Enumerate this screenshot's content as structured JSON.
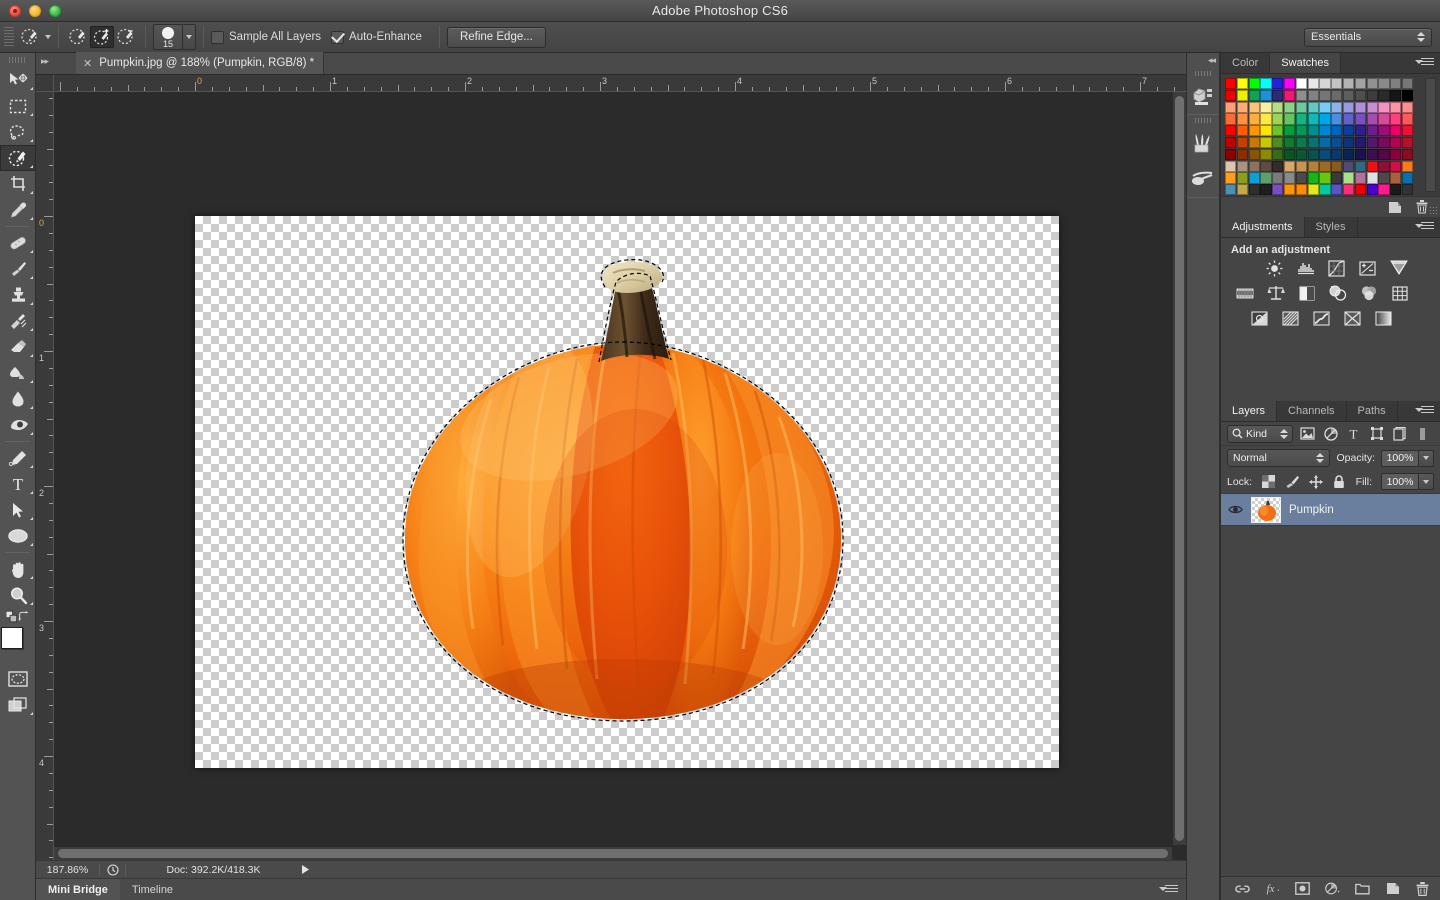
{
  "window": {
    "title": "Adobe Photoshop CS6",
    "traffic_lights": [
      "close",
      "minimize",
      "zoom"
    ]
  },
  "options_bar": {
    "tool_preset_label": "quick-selection-tool-preset",
    "mode_buttons": [
      "new-selection",
      "add-to-selection",
      "subtract-from-selection"
    ],
    "active_mode_index": 1,
    "brush_size": "15",
    "sample_all_layers": {
      "label": "Sample All Layers",
      "checked": false
    },
    "auto_enhance": {
      "label": "Auto-Enhance",
      "checked": true
    },
    "refine_edge": "Refine Edge...",
    "workspace": "Essentials"
  },
  "toolbox": {
    "tools": [
      {
        "name": "move-tool",
        "active": false
      },
      {
        "name": "rectangular-marquee-tool",
        "active": false
      },
      {
        "name": "lasso-tool",
        "active": false
      },
      {
        "name": "quick-selection-tool",
        "active": true
      },
      {
        "name": "crop-tool",
        "active": false
      },
      {
        "name": "eyedropper-tool",
        "active": false
      },
      {
        "name": "spot-healing-brush-tool",
        "active": false
      },
      {
        "name": "brush-tool",
        "active": false
      },
      {
        "name": "clone-stamp-tool",
        "active": false
      },
      {
        "name": "history-brush-tool",
        "active": false
      },
      {
        "name": "eraser-tool",
        "active": false
      },
      {
        "name": "gradient-tool",
        "active": false
      },
      {
        "name": "blur-tool",
        "active": false
      },
      {
        "name": "dodge-tool",
        "active": false
      },
      {
        "name": "pen-tool",
        "active": false
      },
      {
        "name": "horizontal-type-tool",
        "active": false
      },
      {
        "name": "path-selection-tool",
        "active": false
      },
      {
        "name": "ellipse-tool",
        "active": false
      },
      {
        "name": "hand-tool",
        "active": false
      },
      {
        "name": "zoom-tool",
        "active": false
      }
    ],
    "foreground_color": "#ffffff",
    "background_color": "#ffffff",
    "quick_mask": "edit-in-quick-mask-mode",
    "screen_mode": "change-screen-mode"
  },
  "document": {
    "tab_title": "Pumpkin.jpg @ 188% (Pumpkin, RGB/8) *",
    "ruler_h_labels": [
      "0",
      "1",
      "2",
      "3",
      "4",
      "5",
      "6",
      "7"
    ],
    "ruler_v_labels": [
      "0",
      "1",
      "2",
      "3",
      "4"
    ],
    "canvas_alt": "pumpkin-on-transparent-background"
  },
  "status_bar": {
    "zoom": "187.86%",
    "doc_info": "Doc: 392.2K/418.3K"
  },
  "bottom_tabs": [
    {
      "label": "Mini Bridge",
      "active": true
    },
    {
      "label": "Timeline",
      "active": false
    }
  ],
  "mini_dock": {
    "items": [
      "history-panel-icon",
      "brush-panel-icon",
      "tool-presets-icon"
    ]
  },
  "panels": {
    "color_swatches": {
      "tabs": [
        {
          "label": "Color",
          "active": false
        },
        {
          "label": "Swatches",
          "active": true
        }
      ],
      "swatch_rows": [
        [
          "#ff0000",
          "#ffff00",
          "#00ff00",
          "#00ffff",
          "#2222dd",
          "#ff00ff",
          "#ffffff",
          "#e8e8e8",
          "#d6d6d6",
          "#c4c4c4",
          "#b3b3b3",
          "#a2a2a2",
          "#919191",
          "#8a8a8a",
          "#808080",
          "#777777"
        ],
        [
          "#ee0000",
          "#eeee00",
          "#12a05a",
          "#1f8fd8",
          "#2b2b7a",
          "#f01a72",
          "#8e8e8e",
          "#828282",
          "#767676",
          "#6a6a6a",
          "#5e5e5e",
          "#4f4f4f",
          "#3c3c3c",
          "#2b2b2b",
          "#161616",
          "#000000"
        ],
        [
          "#ff9e72",
          "#ffab73",
          "#ffc27a",
          "#fcf0a0",
          "#b6dd87",
          "#8fd18a",
          "#6fc9a0",
          "#63c9c4",
          "#77cdf5",
          "#8fb2e8",
          "#9a9ade",
          "#b08fd8",
          "#c78ed0",
          "#f291c3",
          "#ff94a8",
          "#ff8f8f"
        ],
        [
          "#ff6a33",
          "#ff9240",
          "#ffae3e",
          "#ffe84a",
          "#9ed35a",
          "#67c261",
          "#13b47d",
          "#12b9b9",
          "#00a7e8",
          "#4e8ede",
          "#5d63c8",
          "#7a4fc0",
          "#a64bb0",
          "#d84a9a",
          "#ff3f7e",
          "#ff5a5a"
        ],
        [
          "#ff0000",
          "#ff5e00",
          "#ff9500",
          "#ffe500",
          "#6cc424",
          "#00a13c",
          "#009a55",
          "#008f8f",
          "#0086d6",
          "#0065c0",
          "#0b3f9e",
          "#2d1f8c",
          "#6b1e8c",
          "#9c0d7a",
          "#ee0066",
          "#ee1133"
        ],
        [
          "#c40000",
          "#c44000",
          "#c87a00",
          "#c8c800",
          "#4f8c1e",
          "#0e7a30",
          "#0c7a4a",
          "#0b7272",
          "#0a6aa8",
          "#0a4f96",
          "#0b3578",
          "#241a6e",
          "#55176e",
          "#7a0a60",
          "#b80052",
          "#b81029"
        ],
        [
          "#8b0000",
          "#8b2f00",
          "#8b5500",
          "#8b8b00",
          "#376b17",
          "#0a5622",
          "#0a5636",
          "#0a5252",
          "#084d78",
          "#083a6b",
          "#082556",
          "#1a124f",
          "#3c0f4f",
          "#560745",
          "#8c003c",
          "#8c0c1f"
        ],
        [
          "#dcc6ad",
          "#a99184",
          "#8c7061",
          "#5d4c42",
          "#332c29",
          "#d8a86a",
          "#c89456",
          "#b57f3c",
          "#9e6a2a",
          "#8a5a1f",
          "#4c4c76",
          "#2e6b80",
          "#ee1111",
          "#8c1035",
          "#d01046",
          "#ff7a1a"
        ],
        [
          "#ff9d1c",
          "#8b9e1c",
          "#0e9fd8",
          "#5da16a",
          "#7a7a7a",
          "#8a8a8a",
          "#4a4a4a",
          "#17b51a",
          "#6ac412",
          "#3a3a3a",
          "#a9e08a",
          "#b3709a",
          "#e0e0e0",
          "#4a4a4a",
          "#a8613a",
          "#0d6fa8"
        ],
        [
          "#4b8fb2",
          "#c3a84e",
          "#2e2e2e",
          "#1f1f1f",
          "#7a4fc0",
          "#ff9500",
          "#ff8c00",
          "#e3e81a",
          "#00c9a0",
          "#5b52c8",
          "#ff2d78",
          "#ee0000",
          "#4b00d0",
          "#ff1a8c",
          "#1a1a1a",
          "#333333"
        ]
      ],
      "footer_buttons": [
        "new-swatch-icon",
        "delete-swatch-icon"
      ]
    },
    "adjustments": {
      "tabs": [
        {
          "label": "Adjustments",
          "active": true
        },
        {
          "label": "Styles",
          "active": false
        }
      ],
      "heading": "Add an adjustment",
      "rows": [
        [
          "brightness-contrast-icon",
          "levels-icon",
          "curves-icon",
          "exposure-icon",
          "vibrance-icon"
        ],
        [
          "hue-saturation-icon",
          "color-balance-icon",
          "black-white-icon",
          "photo-filter-icon",
          "channel-mixer-icon",
          "color-lookup-icon"
        ],
        [
          "invert-icon",
          "posterize-icon",
          "threshold-icon",
          "selective-color-icon",
          "gradient-map-icon"
        ]
      ]
    },
    "layers": {
      "tabs": [
        {
          "label": "Layers",
          "active": true
        },
        {
          "label": "Channels",
          "active": false
        },
        {
          "label": "Paths",
          "active": false
        }
      ],
      "filter_label": "Kind",
      "filter_icons": [
        "pixel-filter-icon",
        "adjustment-filter-icon",
        "type-filter-icon",
        "shape-filter-icon",
        "smart-object-filter-icon",
        "filter-toggle-icon"
      ],
      "blend_mode": "Normal",
      "opacity_label": "Opacity:",
      "opacity_value": "100%",
      "lock_label": "Lock:",
      "lock_icons": [
        "lock-transparent-pixels-icon",
        "lock-image-pixels-icon",
        "lock-position-icon",
        "lock-all-icon"
      ],
      "fill_label": "Fill:",
      "fill_value": "100%",
      "items": [
        {
          "name": "Pumpkin",
          "visible": true,
          "selected": true
        }
      ],
      "footer_buttons": [
        "link-layers-icon",
        "layer-style-icon",
        "layer-mask-icon",
        "new-adjustment-layer-icon",
        "new-group-icon",
        "new-layer-icon",
        "delete-layer-icon"
      ]
    }
  },
  "colors": {
    "accent_selection": "#6a7f9e",
    "panel_bg": "#454545",
    "canvas_bg": "#2b2b2b",
    "pumpkin_orange": "#f07818"
  }
}
